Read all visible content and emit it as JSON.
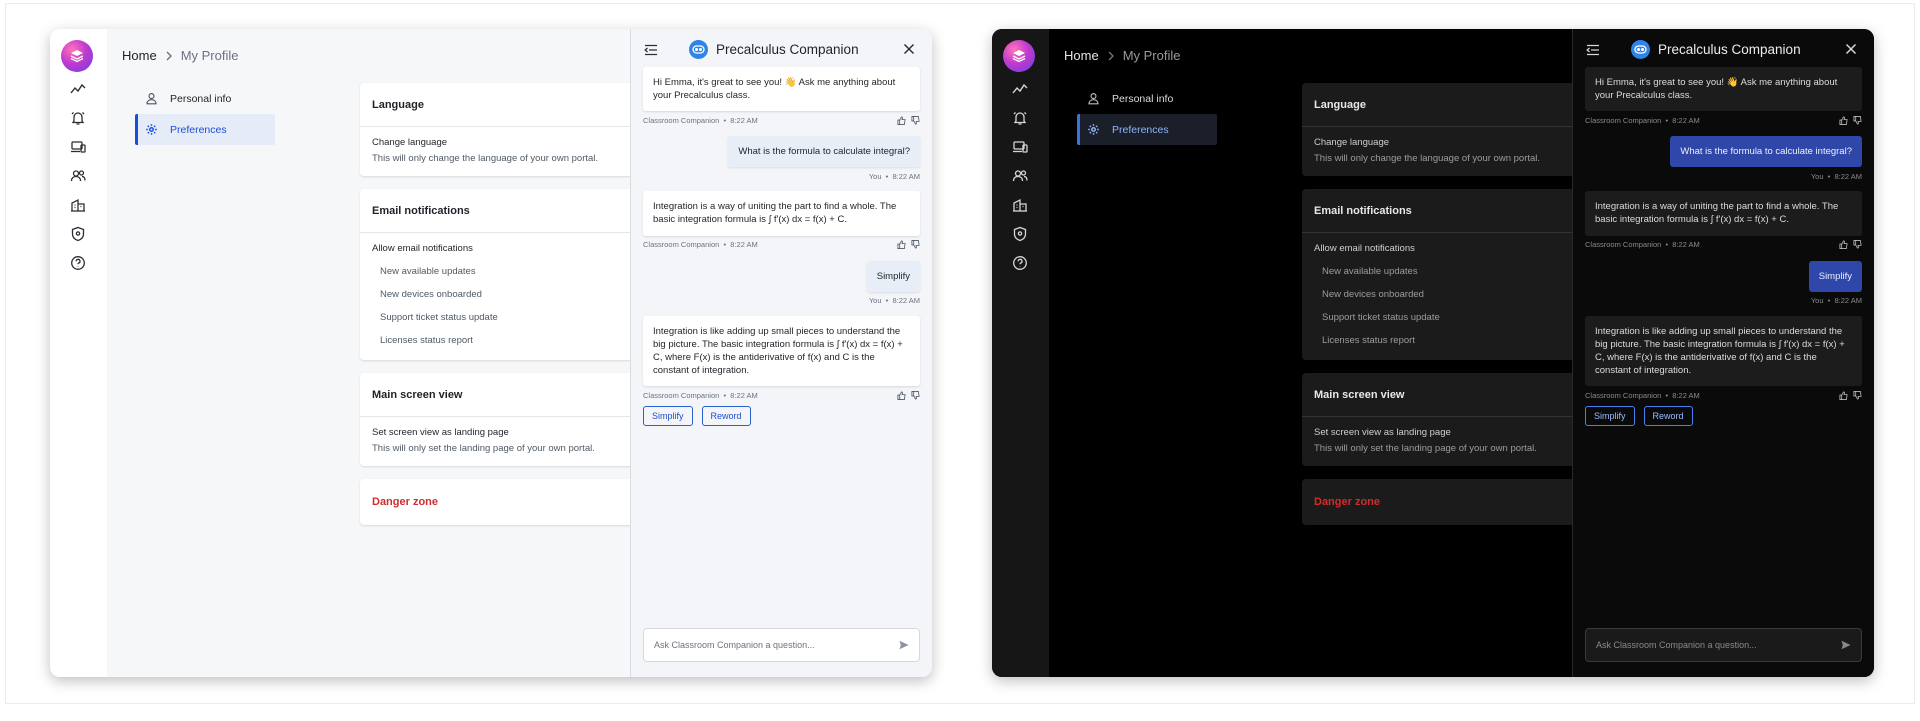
{
  "breadcrumb": {
    "home": "Home",
    "current": "My Profile"
  },
  "subnav": {
    "items": [
      {
        "label": "Personal info"
      },
      {
        "label": "Preferences"
      }
    ]
  },
  "cards": {
    "language": {
      "title": "Language",
      "item_title": "Change language",
      "item_desc": "This will only change the language of your own portal."
    },
    "email": {
      "title": "Email notifications",
      "item_title": "Allow email notifications",
      "options": [
        "New available updates",
        "New devices onboarded",
        "Support ticket status update",
        "Licenses status report"
      ]
    },
    "main_screen": {
      "title": "Main screen view",
      "item_title": "Set screen view as landing page",
      "item_desc": "This will only set the landing page of your own portal."
    },
    "danger": {
      "title": "Danger zone"
    }
  },
  "chat": {
    "title": "Precalculus Companion",
    "messages": [
      {
        "from": "bot",
        "text": "Hi Emma, it's great to see you! 👋 Ask me anything about your Precalculus class.",
        "sender": "Classroom Companion",
        "time": "8:22 AM"
      },
      {
        "from": "user",
        "text": "What is the formula to calculate integral?",
        "sender": "You",
        "time": "8:22 AM"
      },
      {
        "from": "bot",
        "text": "Integration is a way of uniting the part to find a whole.  The basic integration formula is ∫ f'(x) dx = f(x) + C.",
        "sender": "Classroom Companion",
        "time": "8:22 AM"
      },
      {
        "from": "user",
        "text": "Simplify",
        "sender": "You",
        "time": "8:22 AM"
      },
      {
        "from": "bot",
        "text": "Integration is like adding up small pieces to understand the big picture.  The basic integration formula is ∫ f'(x) dx = f(x) + C, where F(x) is the antiderivative of f(x) and C is the constant of integration.",
        "sender": "Classroom Companion",
        "time": "8:22 AM"
      }
    ],
    "chips": [
      "Simplify",
      "Reword"
    ],
    "input_placeholder": "Ask Classroom Companion a question...",
    "separator": "•"
  },
  "theme_colors": {
    "accent_light": "#1d4ed8",
    "accent_dark": "#3d73e0",
    "danger": "#d12c2c",
    "user_bubble_dark": "#2f47a8"
  },
  "icons": [
    "app-logo-icon",
    "analytics-icon",
    "alerts-icon",
    "devices-icon",
    "users-icon",
    "buildings-icon",
    "security-icon",
    "help-icon",
    "person-icon",
    "gear-icon",
    "collapse-icon",
    "close-icon",
    "bot-icon",
    "thumb-up-icon",
    "thumb-down-icon",
    "send-icon"
  ]
}
